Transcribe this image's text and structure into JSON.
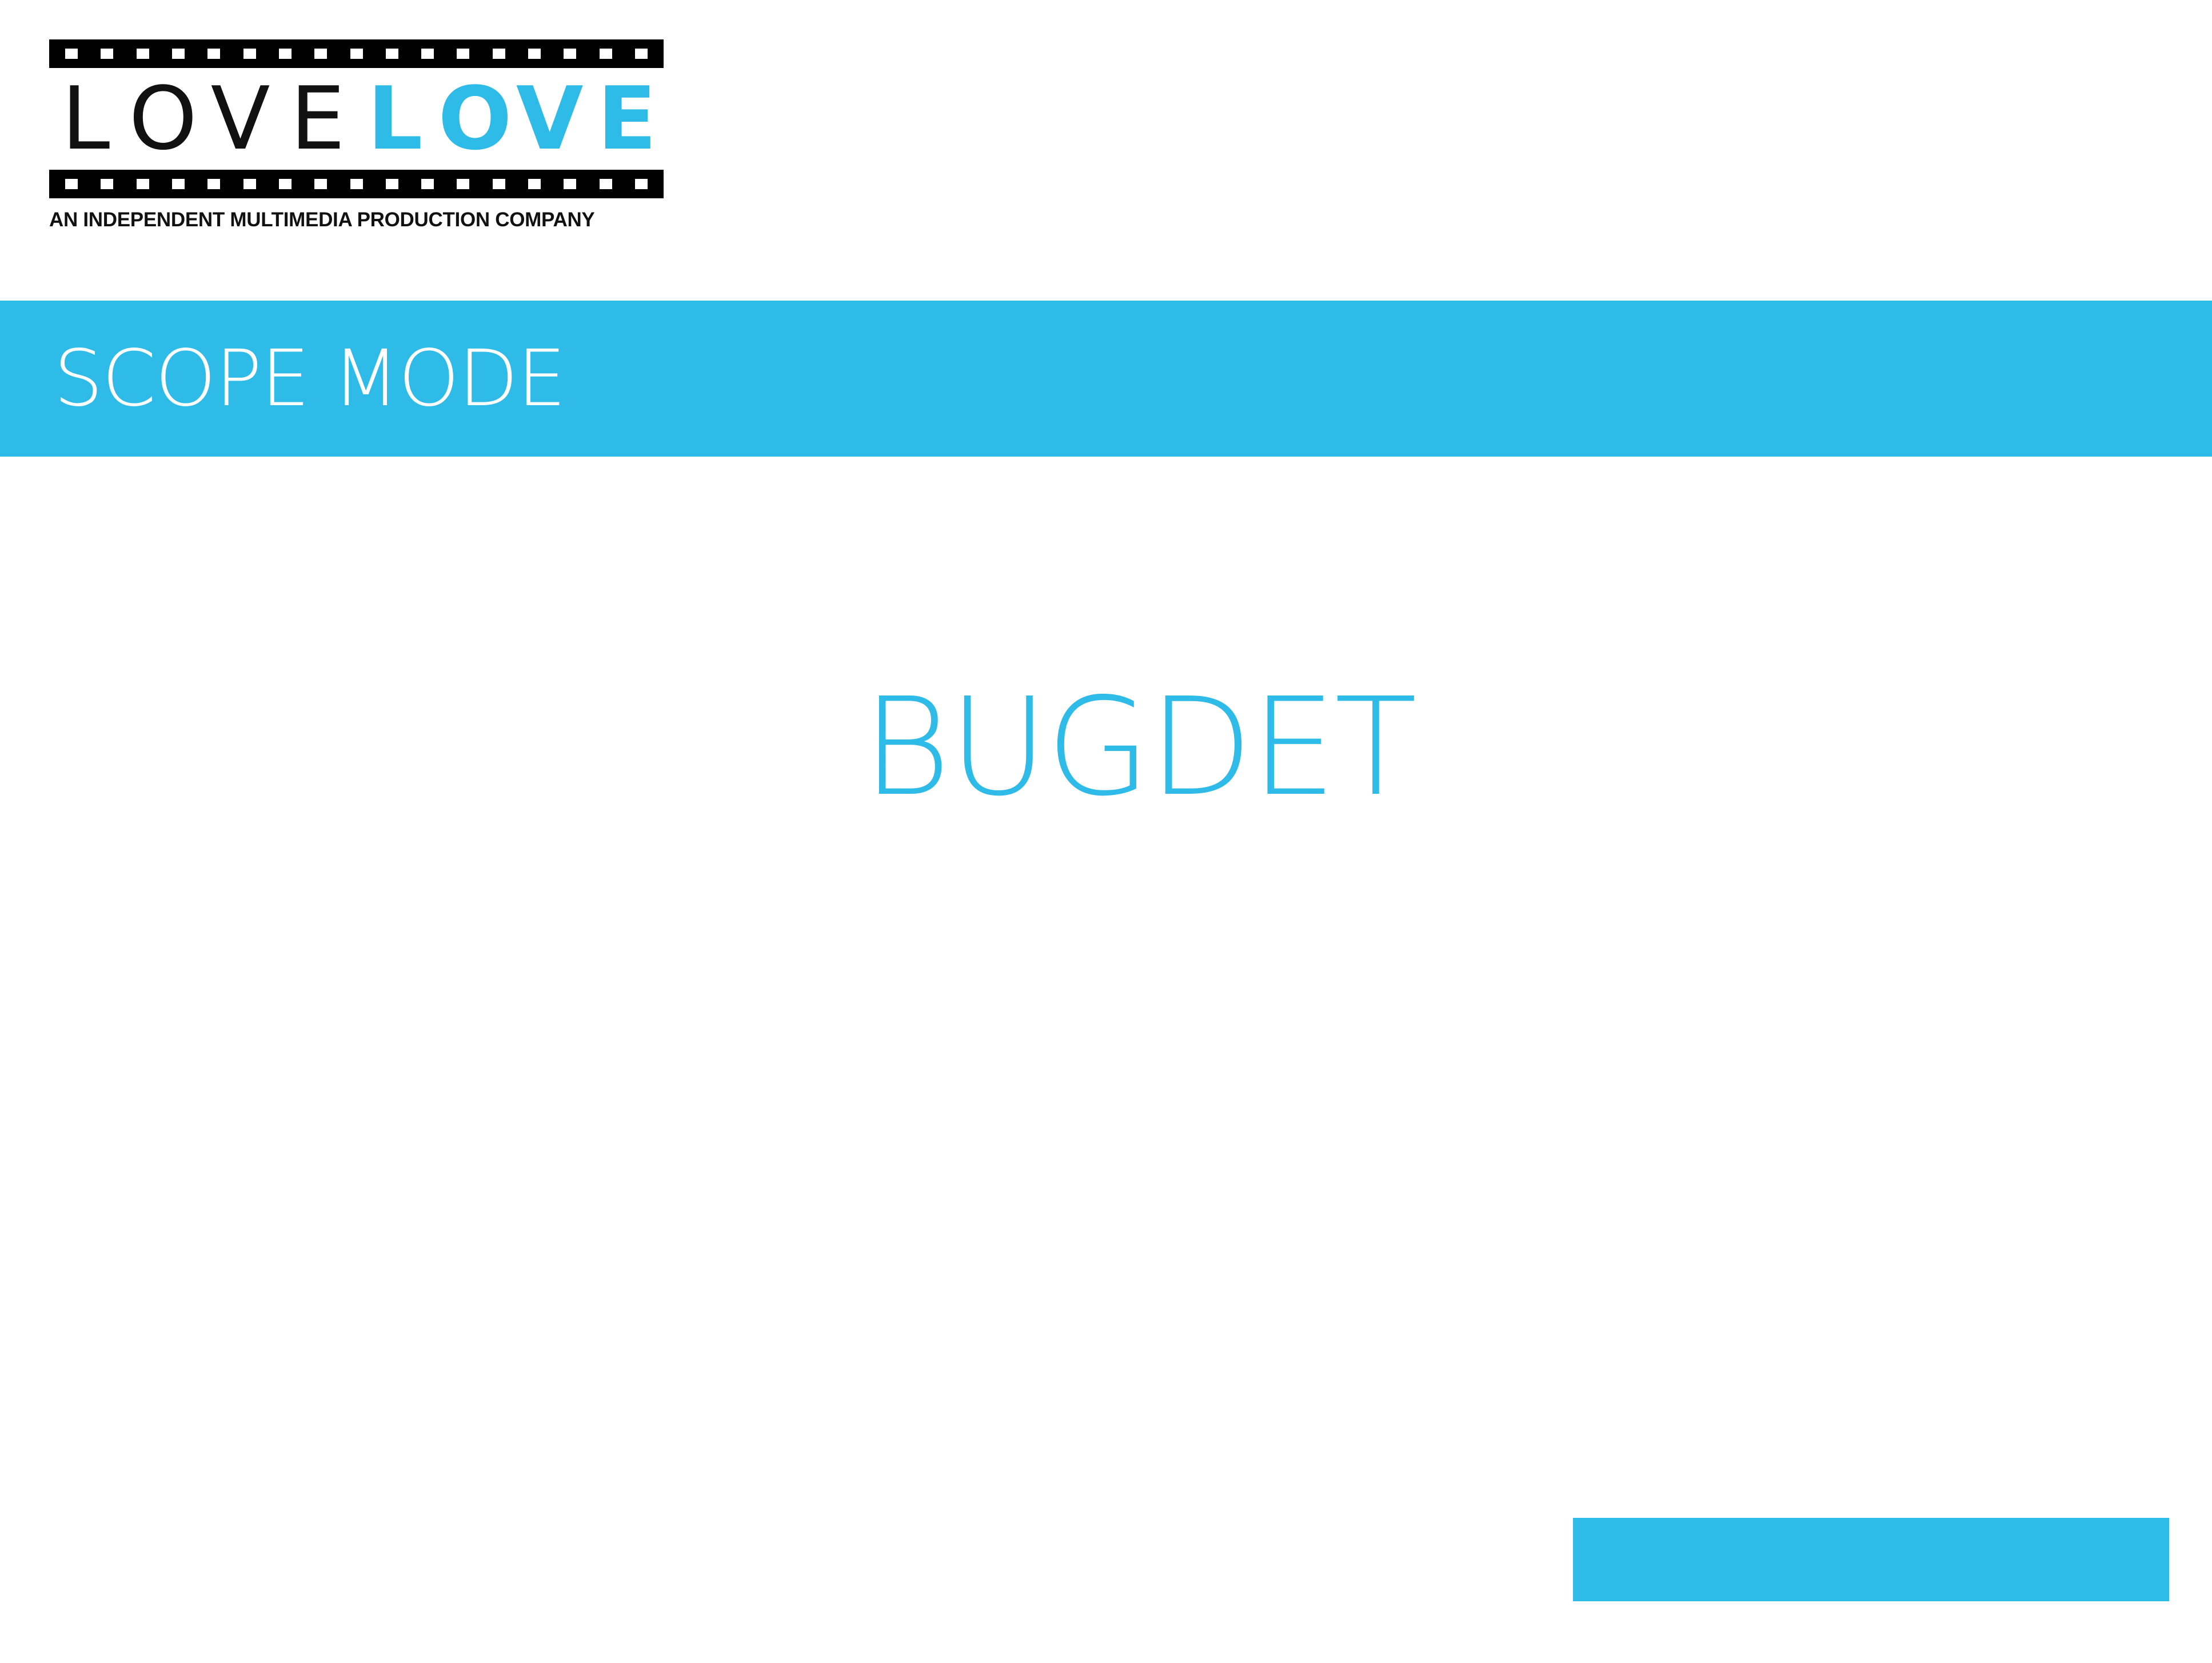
{
  "logo": {
    "wordmark_dark": [
      "L",
      "O",
      "V",
      "E"
    ],
    "wordmark_blue": [
      "L",
      "O",
      "V",
      "E"
    ],
    "tagline": "AN INDEPENDENT MULTIMEDIA PRODUCTION COMPANY"
  },
  "header": {
    "title": "SCOPE MODE"
  },
  "main": {
    "heading": "BUGDET"
  },
  "colors": {
    "accent": "#2ebbe7",
    "text_dark": "#111111",
    "background": "#ffffff"
  }
}
